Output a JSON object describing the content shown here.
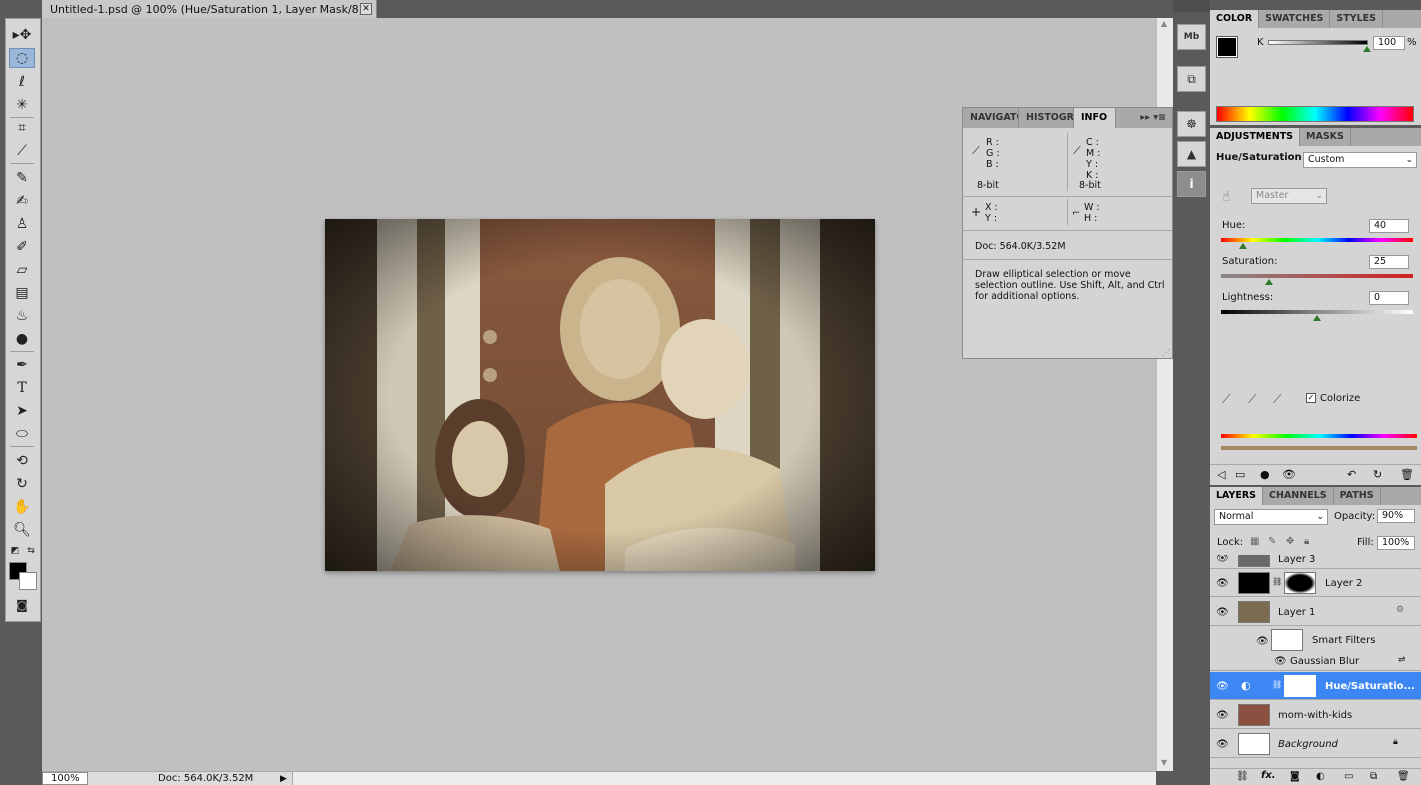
{
  "document": {
    "tab_title": "Untitled-1.psd @ 100% (Hue/Saturation 1, Layer Mask/8) *",
    "zoom": "100%",
    "doc_size": "Doc: 564.0K/3.52M"
  },
  "toolbar": {
    "tools": [
      "move-tool",
      "elliptical-marquee-tool",
      "lasso-tool",
      "magic-wand-tool",
      "crop-tool",
      "eyedropper-tool",
      "spot-healing-tool",
      "brush-tool",
      "clone-stamp-tool",
      "history-brush-tool",
      "eraser-tool",
      "gradient-tool",
      "blur-tool",
      "dodge-tool",
      "pen-tool",
      "type-tool",
      "path-selection-tool",
      "ellipse-tool",
      "3d-rotate-tool",
      "3d-orbit-tool",
      "hand-tool",
      "zoom-tool"
    ],
    "type_glyph": "T",
    "foreground_color": "#000000",
    "background_color": "#ffffff"
  },
  "info_panel": {
    "tabs": [
      "NAVIGATO",
      "HISTOGRA",
      "INFO"
    ],
    "rgb_labels": [
      "R :",
      "G :",
      "B :"
    ],
    "cmyk_labels": [
      "C :",
      "M :",
      "Y :",
      "K :"
    ],
    "bit_left": "8-bit",
    "bit_right": "8-bit",
    "xy_labels": [
      "X :",
      "Y :"
    ],
    "wh_labels": [
      "W :",
      "H :"
    ],
    "doc": "Doc: 564.0K/3.52M",
    "hint": "Draw elliptical selection or move selection outline.  Use Shift, Alt, and Ctrl for additional options."
  },
  "color_panel": {
    "tabs": [
      "COLOR",
      "SWATCHES",
      "STYLES"
    ],
    "channel_label": "K",
    "value": "100",
    "unit": "%"
  },
  "adjustments_panel": {
    "tabs": [
      "ADJUSTMENTS",
      "MASKS"
    ],
    "title": "Hue/Saturation",
    "preset": "Custom",
    "channel": "Master",
    "hue_label": "Hue:",
    "hue_value": "40",
    "saturation_label": "Saturation:",
    "saturation_value": "25",
    "lightness_label": "Lightness:",
    "lightness_value": "0",
    "colorize_label": "Colorize",
    "colorize_checked": true
  },
  "layers_panel": {
    "tabs": [
      "LAYERS",
      "CHANNELS",
      "PATHS"
    ],
    "blend_mode": "Normal",
    "opacity_label": "Opacity:",
    "opacity_value": "90%",
    "lock_label": "Lock:",
    "fill_label": "Fill:",
    "fill_value": "100%",
    "layers": [
      {
        "name": "Layer 3"
      },
      {
        "name": "Layer 2"
      },
      {
        "name": "Layer 1"
      },
      {
        "name": "Smart Filters"
      },
      {
        "name": "Gaussian Blur"
      },
      {
        "name": "Hue/Saturatio..."
      },
      {
        "name": "mom-with-kids"
      },
      {
        "name": "Background"
      }
    ],
    "footer_fx": "fx."
  },
  "iconcol": {
    "mb_label": "Mb"
  }
}
